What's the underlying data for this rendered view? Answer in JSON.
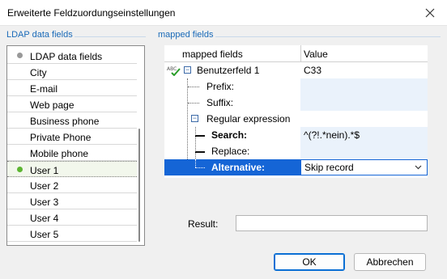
{
  "window": {
    "title": "Erweiterte Feldzuordungseinstellungen"
  },
  "left": {
    "section_label": "LDAP data fields",
    "items": [
      {
        "label": "LDAP data fields",
        "marker": "gray"
      },
      {
        "label": "City"
      },
      {
        "label": "E-mail"
      },
      {
        "label": "Web page"
      },
      {
        "label": "Business phone"
      },
      {
        "label": "Private Phone"
      },
      {
        "label": "Mobile phone"
      },
      {
        "label": "User 1",
        "marker": "green",
        "selected": true
      },
      {
        "label": "User 2"
      },
      {
        "label": "User 3"
      },
      {
        "label": "User 4"
      },
      {
        "label": "User 5"
      }
    ]
  },
  "right": {
    "section_label": "mapped fields",
    "columns": {
      "field": "mapped fields",
      "value": "Value"
    },
    "rows": {
      "root": {
        "label": "Benutzerfeld 1",
        "value": "C33"
      },
      "prefix": {
        "label": "Prefix:",
        "value": ""
      },
      "suffix": {
        "label": "Suffix:",
        "value": ""
      },
      "regex": {
        "label": "Regular expression"
      },
      "search": {
        "label": "Search:",
        "value": "^(?!.*nein).*$"
      },
      "replace": {
        "label": "Replace:",
        "value": ""
      },
      "alternative": {
        "label": "Alternative:",
        "value": "Skip record"
      }
    }
  },
  "result": {
    "label": "Result:",
    "value": ""
  },
  "buttons": {
    "ok": "OK",
    "cancel": "Abbrechen"
  },
  "colors": {
    "accent": "#1565d6",
    "section_label": "#1a6ab8",
    "selected_marker": "#5cb531",
    "marker": "#999999"
  }
}
